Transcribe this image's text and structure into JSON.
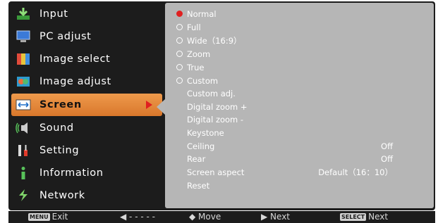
{
  "menu": {
    "items": [
      {
        "label": "Input",
        "icon": "input-icon"
      },
      {
        "label": "PC adjust",
        "icon": "monitor-icon"
      },
      {
        "label": "Image select",
        "icon": "image-select-icon"
      },
      {
        "label": "Image adjust",
        "icon": "image-adjust-icon"
      },
      {
        "label": "Screen",
        "icon": "screen-icon",
        "active": true
      },
      {
        "label": "Sound",
        "icon": "speaker-icon"
      },
      {
        "label": "Setting",
        "icon": "tools-icon"
      },
      {
        "label": "Information",
        "icon": "info-icon"
      },
      {
        "label": "Network",
        "icon": "network-icon"
      }
    ]
  },
  "screen_options": {
    "normal": "Normal",
    "full": "Full",
    "wide": "Wide（16:9）",
    "zoom": "Zoom",
    "true": "True",
    "custom": "Custom",
    "custom_adj": "Custom adj.",
    "digital_zoom_plus": "Digital zoom +",
    "digital_zoom_minus": "Digital zoom -",
    "keystone": "Keystone",
    "ceiling": {
      "label": "Ceiling",
      "value": "Off"
    },
    "rear": {
      "label": "Rear",
      "value": "Off"
    },
    "screen_aspect": {
      "label": "Screen aspect",
      "value": "Default（16：10）"
    },
    "reset": "Reset",
    "selected": "Normal"
  },
  "footer": {
    "exit_key": "MENU",
    "exit_label": "Exit",
    "back_label": "◀ - - - - -",
    "move_label": "◆ Move",
    "next_label": "▶ Next",
    "select_key": "SELECT",
    "select_next_label": "Next"
  },
  "colors": {
    "active_tab": "#e8873a",
    "selected_radio": "#e02020",
    "panel": "#b6b6b6",
    "background": "#1c1c1c"
  }
}
